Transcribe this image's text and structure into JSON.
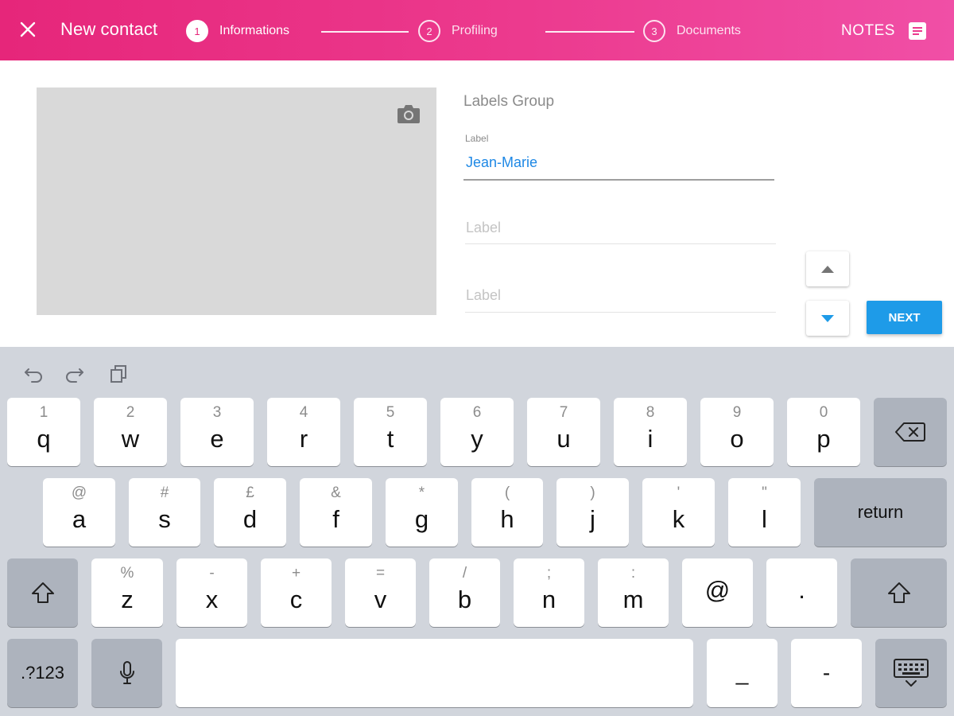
{
  "header": {
    "title": "New contact",
    "steps": [
      {
        "number": "1",
        "label": "Informations",
        "active": true
      },
      {
        "number": "2",
        "label": "Profiling",
        "active": false
      },
      {
        "number": "3",
        "label": "Documents",
        "active": false
      }
    ],
    "notes_label": "NOTES"
  },
  "form": {
    "group_title": "Labels Group",
    "fields": [
      {
        "label": "Label",
        "value": "Jean-Marie"
      },
      {
        "placeholder": "Label"
      },
      {
        "placeholder": "Label"
      }
    ],
    "next_label": "NEXT"
  },
  "keyboard": {
    "row1": [
      {
        "sub": "1",
        "main": "q"
      },
      {
        "sub": "2",
        "main": "w"
      },
      {
        "sub": "3",
        "main": "e"
      },
      {
        "sub": "4",
        "main": "r"
      },
      {
        "sub": "5",
        "main": "t"
      },
      {
        "sub": "6",
        "main": "y"
      },
      {
        "sub": "7",
        "main": "u"
      },
      {
        "sub": "8",
        "main": "i"
      },
      {
        "sub": "9",
        "main": "o"
      },
      {
        "sub": "0",
        "main": "p"
      }
    ],
    "row2": [
      {
        "sub": "@",
        "main": "a"
      },
      {
        "sub": "#",
        "main": "s"
      },
      {
        "sub": "£",
        "main": "d"
      },
      {
        "sub": "&",
        "main": "f"
      },
      {
        "sub": "*",
        "main": "g"
      },
      {
        "sub": "(",
        "main": "h"
      },
      {
        "sub": ")",
        "main": "j"
      },
      {
        "sub": "'",
        "main": "k"
      },
      {
        "sub": "\"",
        "main": "l"
      }
    ],
    "return_label": "return",
    "row3": [
      {
        "sub": "%",
        "main": "z"
      },
      {
        "sub": "-",
        "main": "x"
      },
      {
        "sub": "+",
        "main": "c"
      },
      {
        "sub": "=",
        "main": "v"
      },
      {
        "sub": "/",
        "main": "b"
      },
      {
        "sub": ";",
        "main": "n"
      },
      {
        "sub": ":",
        "main": "m"
      },
      {
        "sub": "",
        "main": "@"
      },
      {
        "sub": "",
        "main": "."
      }
    ],
    "numbers_label": ".?123",
    "underscore_label": "_",
    "dash_label": "-"
  },
  "colors": {
    "header_start": "#e6267a",
    "header_end": "#f04fa6",
    "accent_blue": "#1e9be8",
    "keyboard_bg": "#d1d5dc"
  },
  "icons": [
    "close-icon",
    "camera-icon",
    "notes-icon",
    "arrow-up-icon",
    "arrow-down-icon",
    "undo-icon",
    "redo-icon",
    "paste-icon",
    "backspace-icon",
    "shift-icon",
    "microphone-icon",
    "keyboard-hide-icon"
  ]
}
